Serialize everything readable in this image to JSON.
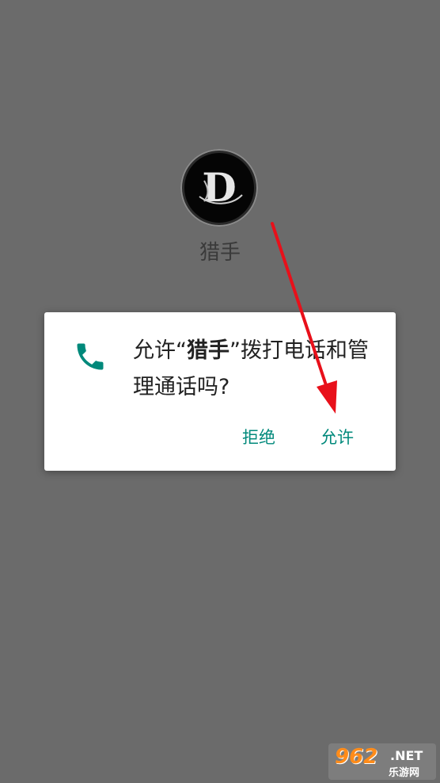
{
  "app": {
    "name": "猎手",
    "icon_letter": "D"
  },
  "dialog": {
    "message_prefix": "允许“",
    "app_name": "猎手",
    "message_suffix": "”拨打电话和管理通话吗?",
    "icon": "phone-icon",
    "deny_label": "拒绝",
    "allow_label": "允许",
    "accent_color": "#00897b"
  },
  "watermark": {
    "logo": "962",
    "domain": ".NET",
    "subtitle": "乐游网"
  },
  "colors": {
    "background": "#6b6b6b",
    "dialog_background": "#ffffff",
    "arrow": "#e8101a"
  }
}
